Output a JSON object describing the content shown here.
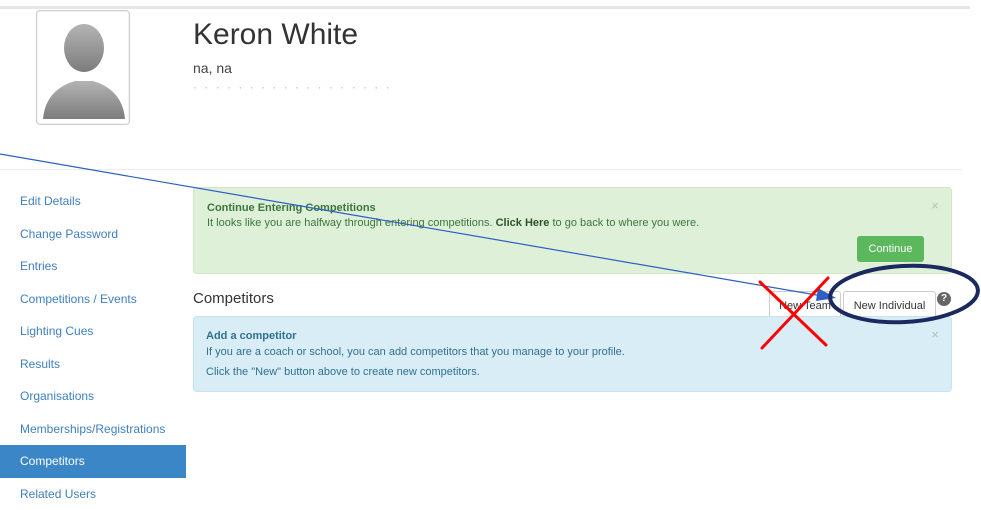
{
  "profile": {
    "name": "Keron White",
    "location": "na, na",
    "faded_line": "· · · · · · · · · · · · · · · · · ·"
  },
  "sidebar": {
    "items": [
      {
        "label": "Edit Details"
      },
      {
        "label": "Change Password"
      },
      {
        "label": "Entries"
      },
      {
        "label": "Competitions / Events"
      },
      {
        "label": "Lighting Cues"
      },
      {
        "label": "Results"
      },
      {
        "label": "Organisations"
      },
      {
        "label": "Memberships/Registrations"
      },
      {
        "label": "Competitors"
      },
      {
        "label": "Related Users"
      }
    ],
    "active_index": 8
  },
  "continue_alert": {
    "title": "Continue Entering Competitions",
    "text_before": "It looks like you are halfway through entering competitions. ",
    "text_bold": "Click Here",
    "text_after": " to go back to where you were.",
    "button_label": "Continue",
    "close_glyph": "×"
  },
  "competitors": {
    "title": "Competitors",
    "team_button_label": "New Team",
    "individual_button_label": "New Individual",
    "help_glyph": "?"
  },
  "info_alert": {
    "title": "Add a competitor",
    "line1": "If you are a coach or school, you can add competitors that you manage to your profile.",
    "line2": "Click the \"New\" button above to create new competitors.",
    "close_glyph": "×"
  },
  "colors": {
    "link": "#3f7fbf",
    "active_nav": "#3a86c6",
    "success_bg": "#dff0d8",
    "success_button": "#5cb85c",
    "info_bg": "#d9edf7",
    "annotation_red": "#ff0000",
    "annotation_navy": "#1a2a5e",
    "annotation_line": "#2d5fc4"
  }
}
